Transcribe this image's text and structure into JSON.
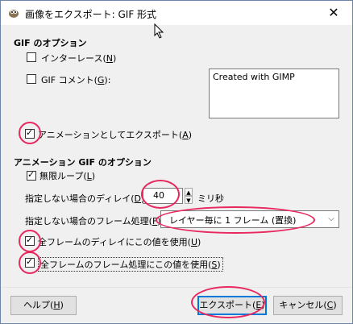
{
  "window": {
    "title": "画像をエクスポート: GIF 形式",
    "close_glyph": "✕"
  },
  "gif_options": {
    "section_title": "GIF のオプション",
    "interlace": {
      "label_pre": "インターレース(",
      "mnemonic": "N",
      "label_post": ")",
      "checked": false
    },
    "comment": {
      "label_pre": "GIF コメント(",
      "mnemonic": "G",
      "label_post": "):",
      "checked": false,
      "value": "Created with GIMP"
    },
    "as_animation": {
      "label_pre": "アニメーションとしてエクスポート(",
      "mnemonic": "A",
      "label_post": ")",
      "checked": true
    }
  },
  "anim_options": {
    "section_title": "アニメーション GIF のオプション",
    "loop_forever": {
      "label_pre": "無限ループ(",
      "mnemonic": "L",
      "label_post": ")",
      "checked": true
    },
    "delay": {
      "label_pre": "指定しない場合のディレイ(",
      "mnemonic": "D",
      "label_post": "):",
      "value": "40",
      "unit": "ミリ秒"
    },
    "disposal": {
      "label_pre": "指定しない場合のフレーム処理(",
      "mnemonic": "F",
      "label_post": "):",
      "value": "レイヤー毎に 1 フレーム (置換)"
    },
    "use_delay_all": {
      "label_pre": "全フレームのディレイにこの値を使用(",
      "mnemonic": "U",
      "label_post": ")",
      "checked": true
    },
    "use_disposal_all": {
      "label_pre": "全フレームのフレーム処理にこの値を使用(",
      "mnemonic": "S",
      "label_post": ")",
      "checked": true
    }
  },
  "buttons": {
    "help": {
      "label_pre": "ヘルプ(",
      "mnemonic": "H",
      "label_post": ")"
    },
    "export": {
      "label_pre": "エクスポート(",
      "mnemonic": "E",
      "label_post": ")"
    },
    "cancel": {
      "label_pre": "キャンセル(",
      "mnemonic": "C",
      "label_post": ")"
    }
  },
  "colors": {
    "highlight": "#e8285e",
    "default_button_border": "#0078d7"
  }
}
